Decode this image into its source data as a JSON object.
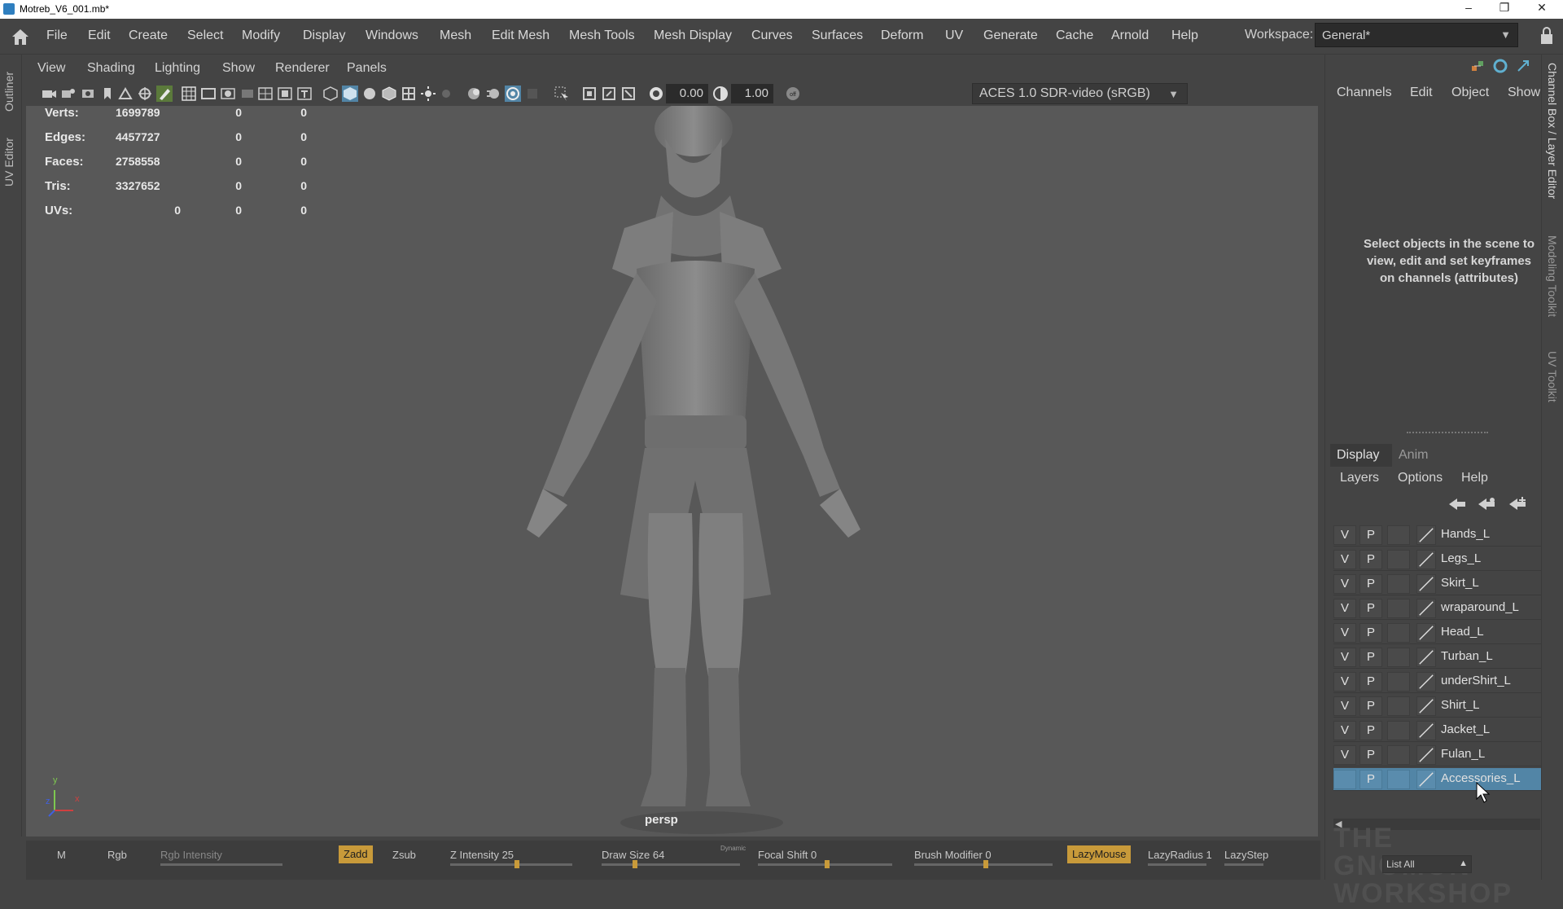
{
  "window": {
    "title": "Motreb_V6_001.mb*",
    "minimize": "–",
    "maximize": "❐",
    "close": "✕"
  },
  "menubar": {
    "items": [
      "File",
      "Edit",
      "Create",
      "Select",
      "Modify",
      "Display",
      "Windows",
      "Mesh",
      "Edit Mesh",
      "Mesh Tools",
      "Mesh Display",
      "Curves",
      "Surfaces",
      "Deform",
      "UV",
      "Generate",
      "Cache",
      "Arnold",
      "Help"
    ],
    "workspace_label": "Workspace:",
    "workspace_value": "General*"
  },
  "left_tabs": [
    "Outliner",
    "UV Editor"
  ],
  "panel_menu": [
    "View",
    "Shading",
    "Lighting",
    "Show",
    "Renderer",
    "Panels"
  ],
  "toolbar": {
    "exposure": "0.00",
    "gamma": "1.00",
    "colorspace": "ACES 1.0 SDR-video (sRGB)"
  },
  "hud": {
    "rows": [
      {
        "label": "Verts:",
        "v1": "1699789",
        "v2": "0",
        "v3": "0"
      },
      {
        "label": "Edges:",
        "v1": "4457727",
        "v2": "0",
        "v3": "0"
      },
      {
        "label": "Faces:",
        "v1": "2758558",
        "v2": "0",
        "v3": "0"
      },
      {
        "label": "Tris:",
        "v1": "3327652",
        "v2": "0",
        "v3": "0"
      },
      {
        "label": "UVs:",
        "v1": "0",
        "v2": "0",
        "v3": "0"
      }
    ],
    "camera": "persp",
    "axis": {
      "y": "y",
      "z": "z",
      "x": "x"
    }
  },
  "channel_box": {
    "tabs": [
      "Channels",
      "Edit",
      "Object",
      "Show"
    ],
    "message": "Select objects in the scene to view, edit and set keyframes on channels (attributes)"
  },
  "right_tabs": [
    "Channel Box / Layer Editor",
    "Modeling Toolkit",
    "UV Toolkit"
  ],
  "layer_editor": {
    "tabs": [
      "Display",
      "Anim"
    ],
    "menu": [
      "Layers",
      "Options",
      "Help"
    ],
    "layers": [
      {
        "v": "V",
        "p": "P",
        "name": "Hands_L"
      },
      {
        "v": "V",
        "p": "P",
        "name": "Legs_L"
      },
      {
        "v": "V",
        "p": "P",
        "name": "Skirt_L"
      },
      {
        "v": "V",
        "p": "P",
        "name": "wraparound_L"
      },
      {
        "v": "V",
        "p": "P",
        "name": "Head_L"
      },
      {
        "v": "V",
        "p": "P",
        "name": "Turban_L"
      },
      {
        "v": "V",
        "p": "P",
        "name": "underShirt_L"
      },
      {
        "v": "V",
        "p": "P",
        "name": "Shirt_L"
      },
      {
        "v": "V",
        "p": "P",
        "name": "Jacket_L"
      },
      {
        "v": "V",
        "p": "P",
        "name": "Fulan_L"
      },
      {
        "v": "",
        "p": "P",
        "name": "Accessories_L",
        "selected": true
      }
    ],
    "list_all": "List All"
  },
  "statusbar": {
    "m": "M",
    "rgb": "Rgb",
    "rgb_intensity": "Rgb Intensity",
    "zadd": "Zadd",
    "zsub": "Zsub",
    "z_intensity": "Z Intensity 25",
    "draw_size": "Draw Size 64",
    "dynamic": "Dynamic",
    "focal_shift": "Focal Shift 0",
    "brush_modifier": "Brush Modifier 0",
    "lazymouse": "LazyMouse",
    "lazyradius": "LazyRadius 1",
    "lazystep": "LazyStep"
  },
  "watermark": "THE GNOMON WORKSHOP",
  "colors": {
    "bg": "#444444",
    "viewport": "#585858",
    "selected": "#5285a6",
    "accent": "#c89a3a"
  }
}
